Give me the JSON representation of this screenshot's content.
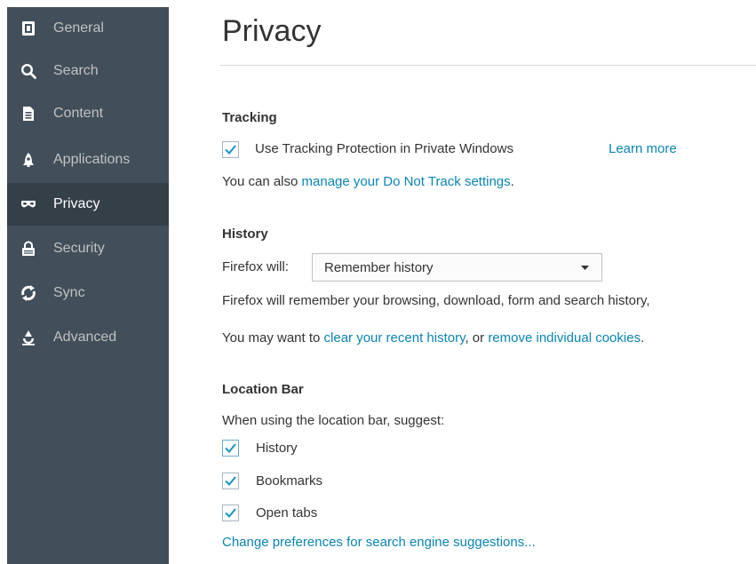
{
  "sidebar": {
    "items": [
      {
        "label": "General",
        "icon": "general-icon",
        "selected": false
      },
      {
        "label": "Search",
        "icon": "search-icon",
        "selected": false
      },
      {
        "label": "Content",
        "icon": "content-icon",
        "selected": false
      },
      {
        "label": "Applications",
        "icon": "applications-icon",
        "selected": false
      },
      {
        "label": "Privacy",
        "icon": "privacy-mask-icon",
        "selected": true
      },
      {
        "label": "Security",
        "icon": "security-lock-icon",
        "selected": false
      },
      {
        "label": "Sync",
        "icon": "sync-icon",
        "selected": false
      },
      {
        "label": "Advanced",
        "icon": "advanced-icon",
        "selected": false
      }
    ]
  },
  "main": {
    "title": "Privacy",
    "tracking": {
      "heading": "Tracking",
      "checkbox_label": "Use Tracking Protection in Private Windows",
      "checkbox_checked": true,
      "learn_more": "Learn more",
      "dnt_prefix": "You can also ",
      "dnt_link": "manage your Do Not Track settings",
      "dnt_suffix": "."
    },
    "history": {
      "heading": "History",
      "select_label": "Firefox will:",
      "select_value": "Remember history",
      "description": "Firefox will remember your browsing, download, form and search history,",
      "clear_prefix": "You may want to ",
      "clear_link": "clear your recent history",
      "clear_middle": ", or ",
      "cookies_link": "remove individual cookies",
      "clear_suffix": "."
    },
    "location_bar": {
      "heading": "Location Bar",
      "prompt": "When using the location bar, suggest:",
      "options": [
        {
          "label": "History",
          "checked": true
        },
        {
          "label": "Bookmarks",
          "checked": true
        },
        {
          "label": "Open tabs",
          "checked": true
        }
      ],
      "change_prefs_link": "Change preferences for search engine suggestions..."
    }
  },
  "colors": {
    "sidebar_bg": "#424f5a",
    "sidebar_selected_bg": "#343f48",
    "link": "#0a84b3",
    "checkmark": "#1a91c9"
  }
}
